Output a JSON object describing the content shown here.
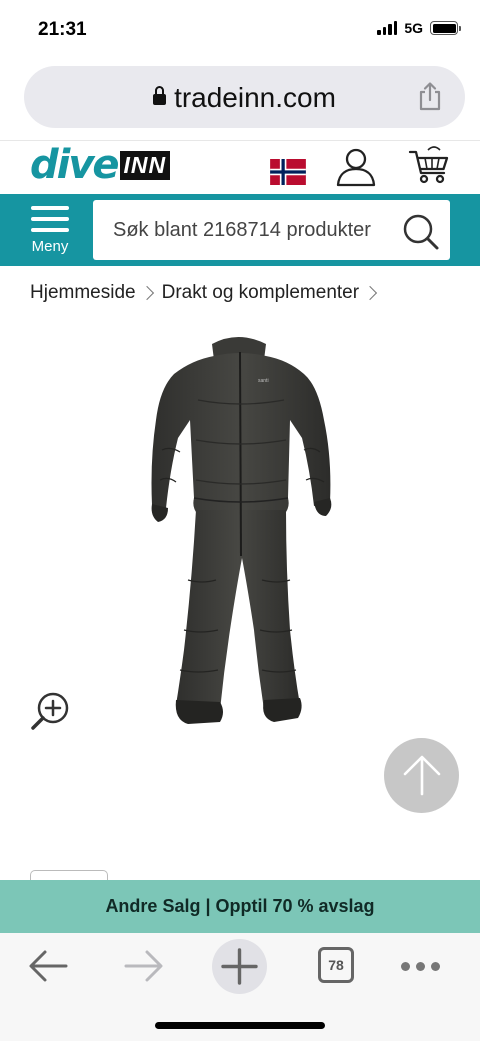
{
  "status_bar": {
    "time": "21:31",
    "network": "5G"
  },
  "browser": {
    "url": "tradeinn.com",
    "open_tabs": "78"
  },
  "site": {
    "logo_dive": "dive",
    "logo_inn": "INN",
    "menu_label": "Meny",
    "search_placeholder": "Søk blant 2168714 produkter"
  },
  "breadcrumb": [
    "Hjemmeside",
    "Drakt og komplementer"
  ],
  "product": {
    "image_alt": "black undersuit",
    "image_label": "santi"
  },
  "promo": {
    "text": "Andre Salg | Opptil 70 % avslag"
  },
  "colors": {
    "brand_teal": "#1695a1",
    "promo_green": "#7cc6b7",
    "toolbar_gray": "#f7f7f7",
    "flag_red": "#ba0c2f",
    "flag_blue": "#00205b"
  },
  "icons": [
    "lock-icon",
    "share-icon",
    "flag-norway-icon",
    "user-icon",
    "cart-icon",
    "hamburger-icon",
    "search-icon",
    "zoom-in-icon",
    "arrow-up-icon",
    "back-arrow-icon",
    "forward-arrow-icon",
    "plus-icon",
    "tabs-icon",
    "more-icon"
  ]
}
